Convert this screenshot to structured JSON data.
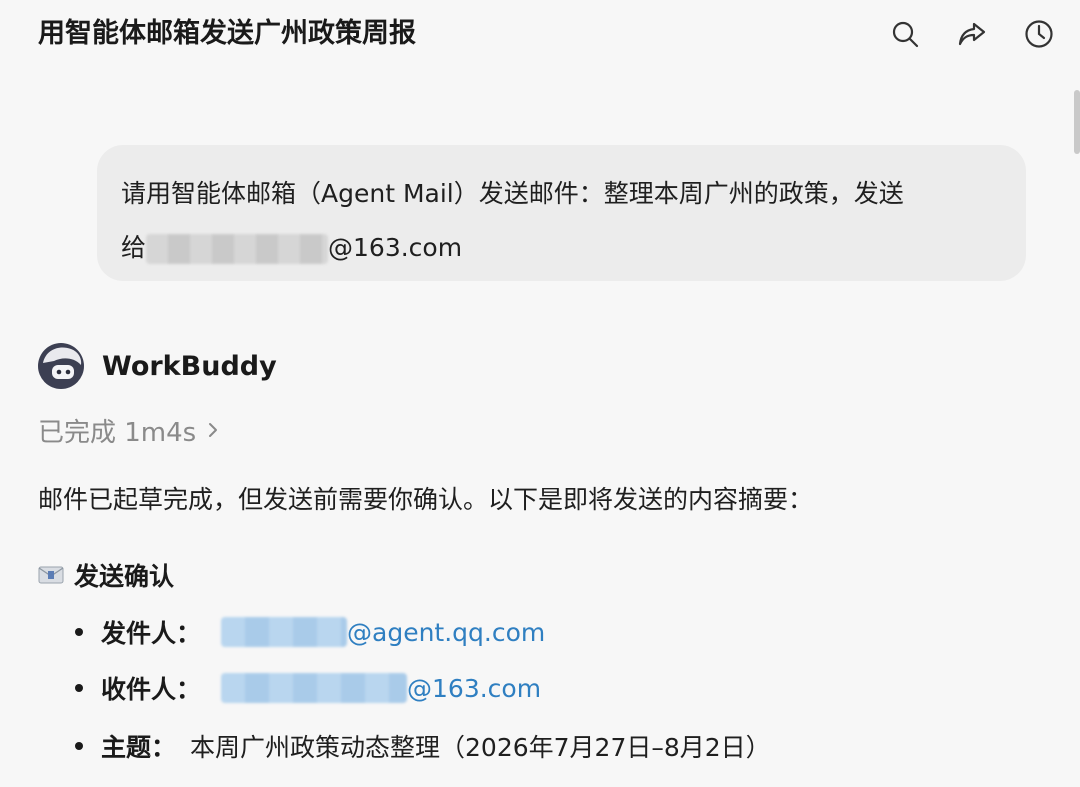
{
  "header": {
    "title": "用智能体邮箱发送广州政策周报",
    "icons": [
      "search-icon",
      "share-icon",
      "history-icon"
    ]
  },
  "user_message": {
    "line1": "请用智能体邮箱（Agent Mail）发送邮件：整理本周广州的政策，发送",
    "line2_prefix": "给",
    "line2_suffix": "@163.com"
  },
  "agent": {
    "name": "WorkBuddy",
    "status": "已完成 1m4s"
  },
  "reply": {
    "intro": "邮件已起草完成，但发送前需要你确认。以下是即将发送的内容摘要：",
    "heading": "发送确认",
    "items": {
      "sender_label": "发件人：",
      "sender_value": "@agent.qq.com",
      "recipient_label": "收件人：",
      "recipient_value": "@163.com",
      "subject_label": "主题：",
      "subject_value": "本周广州政策动态整理（2026年7月27日–8月2日）"
    }
  },
  "colors": {
    "background": "#f7f7f7",
    "bubble": "#ececec",
    "link": "#2f7fc1",
    "muted": "#8a8a8a"
  }
}
